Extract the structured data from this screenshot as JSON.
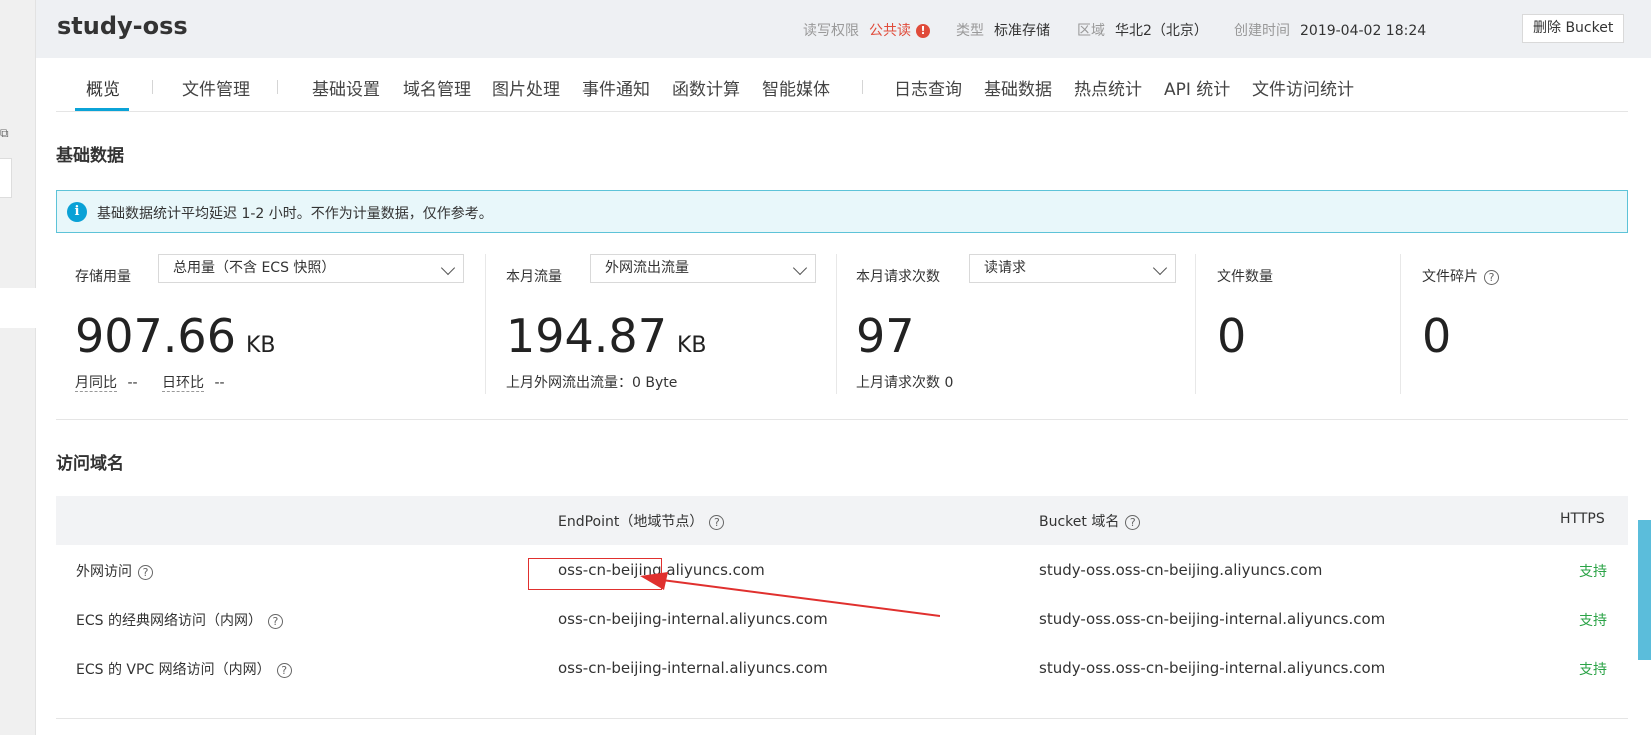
{
  "header": {
    "bucket_name": "study-oss",
    "acl_label": "读写权限",
    "acl_value": "公共读",
    "type_label": "类型",
    "type_value": "标准存储",
    "region_label": "区域",
    "region_value": "华北2（北京）",
    "created_label": "创建时间",
    "created_value": "2019-04-02 18:24",
    "delete_button": "删除 Bucket"
  },
  "tabs": [
    {
      "label": "概览"
    },
    {
      "label": "文件管理"
    },
    {
      "label": "基础设置"
    },
    {
      "label": "域名管理"
    },
    {
      "label": "图片处理"
    },
    {
      "label": "事件通知"
    },
    {
      "label": "函数计算"
    },
    {
      "label": "智能媒体"
    },
    {
      "label": "日志查询"
    },
    {
      "label": "基础数据"
    },
    {
      "label": "热点统计"
    },
    {
      "label": "API 统计"
    },
    {
      "label": "文件访问统计"
    }
  ],
  "basic_data": {
    "title": "基础数据",
    "notice": "基础数据统计平均延迟 1-2 小时。不作为计量数据，仅作参考。",
    "storage": {
      "label": "存储用量",
      "select": "总用量（不含 ECS 快照）",
      "value": "907.66",
      "unit": "KB",
      "mom_label": "月同比",
      "mom_value": "--",
      "dod_label": "日环比",
      "dod_value": "--"
    },
    "traffic": {
      "label": "本月流量",
      "select": "外网流出流量",
      "value": "194.87",
      "unit": "KB",
      "last_month": "上月外网流出流量：0 Byte"
    },
    "requests": {
      "label": "本月请求次数",
      "select": "读请求",
      "value": "97",
      "last_month": "上月请求次数  0"
    },
    "files": {
      "label": "文件数量",
      "value": "0"
    },
    "fragments": {
      "label": "文件碎片",
      "value": "0"
    }
  },
  "domains": {
    "title": "访问域名",
    "columns": [
      "EndPoint（地域节点）",
      "Bucket 域名",
      "HTTPS"
    ],
    "rows": [
      {
        "name": "外网访问",
        "endpoint": "oss-cn-beijing.aliyuncs.com",
        "bucket_domain": "study-oss.oss-cn-beijing.aliyuncs.com",
        "https": "支持"
      },
      {
        "name": "ECS 的经典网络访问（内网）",
        "endpoint": "oss-cn-beijing-internal.aliyuncs.com",
        "bucket_domain": "study-oss.oss-cn-beijing-internal.aliyuncs.com",
        "https": "支持"
      },
      {
        "name": "ECS 的 VPC 网络访问（内网）",
        "endpoint": "oss-cn-beijing-internal.aliyuncs.com",
        "bucket_domain": "study-oss.oss-cn-beijing-internal.aliyuncs.com",
        "https": "支持"
      }
    ]
  },
  "icons": {
    "warning": "exclamation-circle-icon",
    "info": "info-circle-icon",
    "help": "question-circle-icon",
    "dropdown": "chevron-down-icon"
  },
  "colors": {
    "accent": "#0ba3d7",
    "warning": "#e04b3a",
    "support": "#2aa346",
    "annotation": "#e0302e"
  }
}
